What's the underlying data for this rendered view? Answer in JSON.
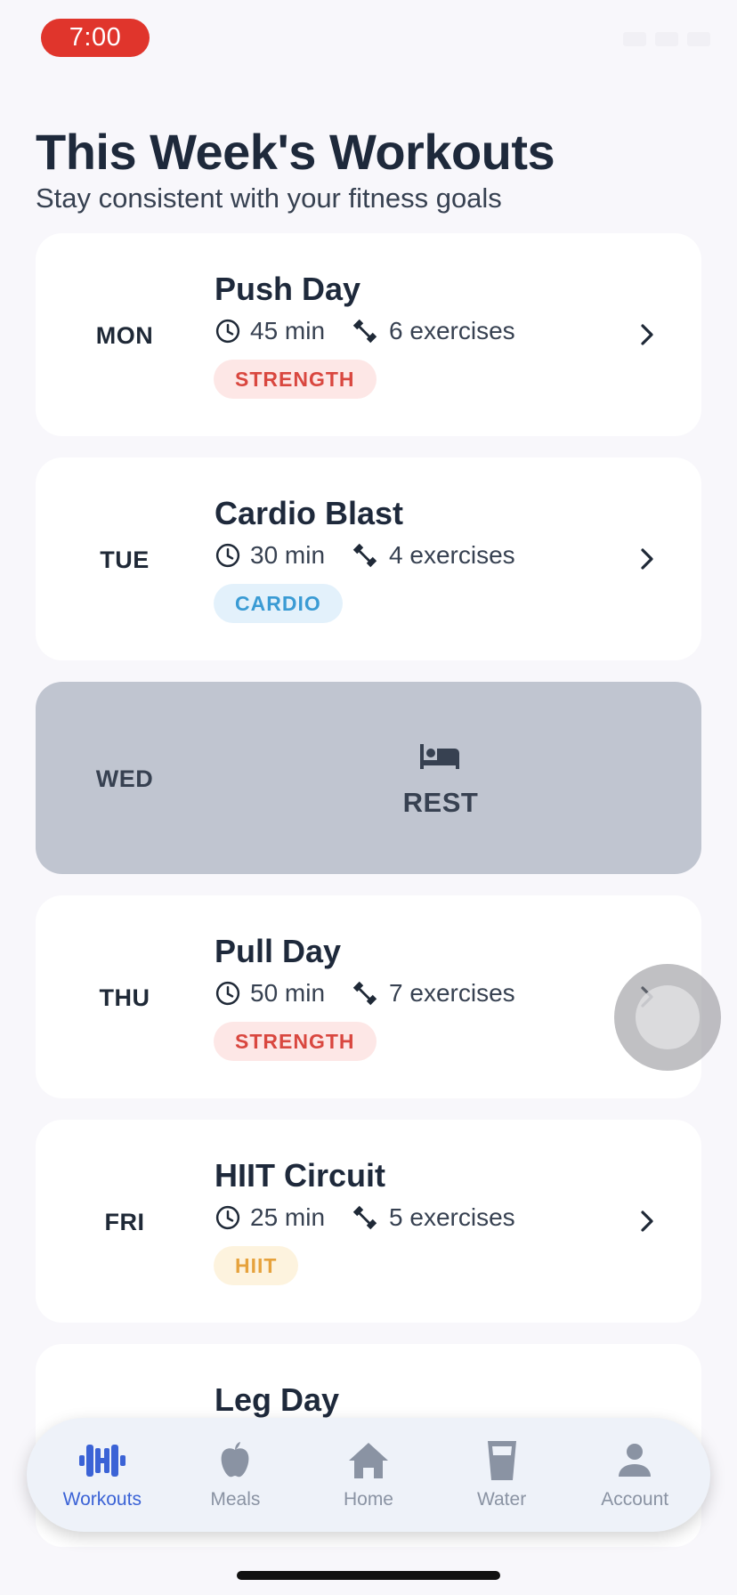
{
  "status_bar": {
    "time": "7:00"
  },
  "header": {
    "title": "This Week's Workouts",
    "subtitle": "Stay consistent with your fitness goals"
  },
  "workouts": [
    {
      "day": "MON",
      "title": "Push Day",
      "duration": "45 min",
      "exercises": "6 exercises",
      "tag": "STRENGTH"
    },
    {
      "day": "TUE",
      "title": "Cardio Blast",
      "duration": "30 min",
      "exercises": "4 exercises",
      "tag": "CARDIO"
    },
    {
      "day": "WED",
      "rest_label": "REST",
      "icon": "bed-icon"
    },
    {
      "day": "THU",
      "title": "Pull Day",
      "duration": "50 min",
      "exercises": "7 exercises",
      "tag": "STRENGTH"
    },
    {
      "day": "FRI",
      "title": "HIIT Circuit",
      "duration": "25 min",
      "exercises": "5 exercises",
      "tag": "HIIT"
    },
    {
      "title": "Leg Day"
    }
  ],
  "nav": {
    "items": [
      {
        "label": "Workouts",
        "icon": "dumbbell-icon",
        "active": true
      },
      {
        "label": "Meals",
        "icon": "apple-icon"
      },
      {
        "label": "Home",
        "icon": "home-icon"
      },
      {
        "label": "Water",
        "icon": "water-glass-icon"
      },
      {
        "label": "Account",
        "icon": "person-icon"
      }
    ]
  },
  "colors": {
    "accent": "#3b63d6",
    "strength": "#d9473f",
    "cardio": "#3a9bd4",
    "hiit": "#e6a23c",
    "rest_bg": "#c0c5d0",
    "time_pill": "#e0352c"
  }
}
